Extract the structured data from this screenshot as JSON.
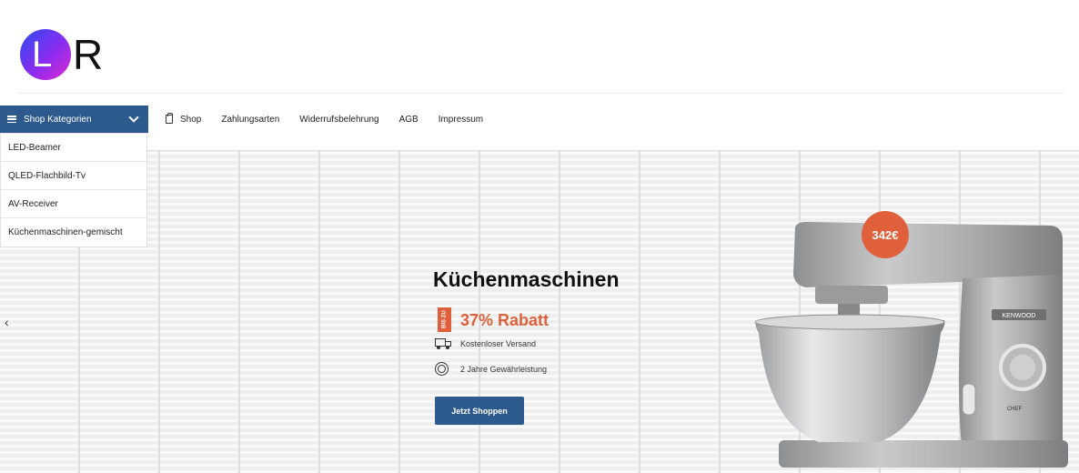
{
  "logo": {
    "letter_l": "L",
    "letter_r": "R"
  },
  "nav": {
    "categories_button": "Shop Kategorien",
    "links": [
      {
        "label": "Shop",
        "icon": "shopping-bag-icon"
      },
      {
        "label": "Zahlungsarten"
      },
      {
        "label": "Widerrufsbelehrung"
      },
      {
        "label": "AGB"
      },
      {
        "label": "Impressum"
      }
    ]
  },
  "categories": [
    "LED-Beamer",
    "QLED-Flachbild-Tv",
    "AV-Receiver",
    "Küchenmaschinen-gemischt"
  ],
  "hero": {
    "title": "Küchenmaschinen",
    "badge": "BIS ZU",
    "discount": "37% Rabatt",
    "features": [
      {
        "icon": "truck-icon",
        "text": "Kostenloser Versand"
      },
      {
        "icon": "warranty-icon",
        "text": "2 Jahre Gewährleistung"
      }
    ],
    "cta": "Jetzt Shoppen",
    "price": "342€",
    "brand": "KENWOOD",
    "model": "CHEF",
    "prev_arrow": "‹"
  },
  "colors": {
    "primary": "#2d5a8c",
    "accent": "#e0603c"
  }
}
